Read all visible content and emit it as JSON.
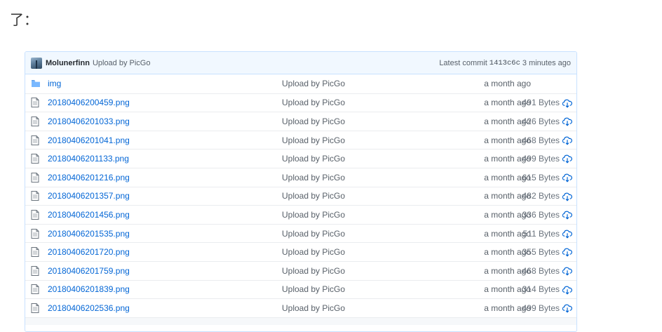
{
  "intro_text": "了：",
  "commit": {
    "author": "Molunerfinn",
    "message": "Upload by PicGo",
    "latest_label": "Latest commit",
    "sha": "1413c6c",
    "time": "3 minutes ago"
  },
  "files": [
    {
      "name": "img",
      "type": "dir",
      "message": "Upload by PicGo",
      "age": "a month ago",
      "size": ""
    },
    {
      "name": "20180406200459.png",
      "type": "file",
      "message": "Upload by PicGo",
      "age": "a month ago",
      "size": "491 Bytes"
    },
    {
      "name": "20180406201033.png",
      "type": "file",
      "message": "Upload by PicGo",
      "age": "a month ago",
      "size": "426 Bytes"
    },
    {
      "name": "20180406201041.png",
      "type": "file",
      "message": "Upload by PicGo",
      "age": "a month ago",
      "size": "468 Bytes"
    },
    {
      "name": "20180406201133.png",
      "type": "file",
      "message": "Upload by PicGo",
      "age": "a month ago",
      "size": "499 Bytes"
    },
    {
      "name": "20180406201216.png",
      "type": "file",
      "message": "Upload by PicGo",
      "age": "a month ago",
      "size": "615 Bytes"
    },
    {
      "name": "20180406201357.png",
      "type": "file",
      "message": "Upload by PicGo",
      "age": "a month ago",
      "size": "482 Bytes"
    },
    {
      "name": "20180406201456.png",
      "type": "file",
      "message": "Upload by PicGo",
      "age": "a month ago",
      "size": "336 Bytes"
    },
    {
      "name": "20180406201535.png",
      "type": "file",
      "message": "Upload by PicGo",
      "age": "a month ago",
      "size": "511 Bytes"
    },
    {
      "name": "20180406201720.png",
      "type": "file",
      "message": "Upload by PicGo",
      "age": "a month ago",
      "size": "355 Bytes"
    },
    {
      "name": "20180406201759.png",
      "type": "file",
      "message": "Upload by PicGo",
      "age": "a month ago",
      "size": "468 Bytes"
    },
    {
      "name": "20180406201839.png",
      "type": "file",
      "message": "Upload by PicGo",
      "age": "a month ago",
      "size": "314 Bytes"
    },
    {
      "name": "20180406202536.png",
      "type": "file",
      "message": "Upload by PicGo",
      "age": "a month ago",
      "size": "499 Bytes"
    }
  ],
  "icons": {
    "folder": "folder-icon",
    "file": "file-icon",
    "download": "cloud-download-icon",
    "avatar": "avatar"
  },
  "colors": {
    "link": "#0366d6",
    "header_bg": "#f1f8ff",
    "header_border": "#c8e1ff",
    "muted": "#586069",
    "folder": "#79b8ff"
  }
}
